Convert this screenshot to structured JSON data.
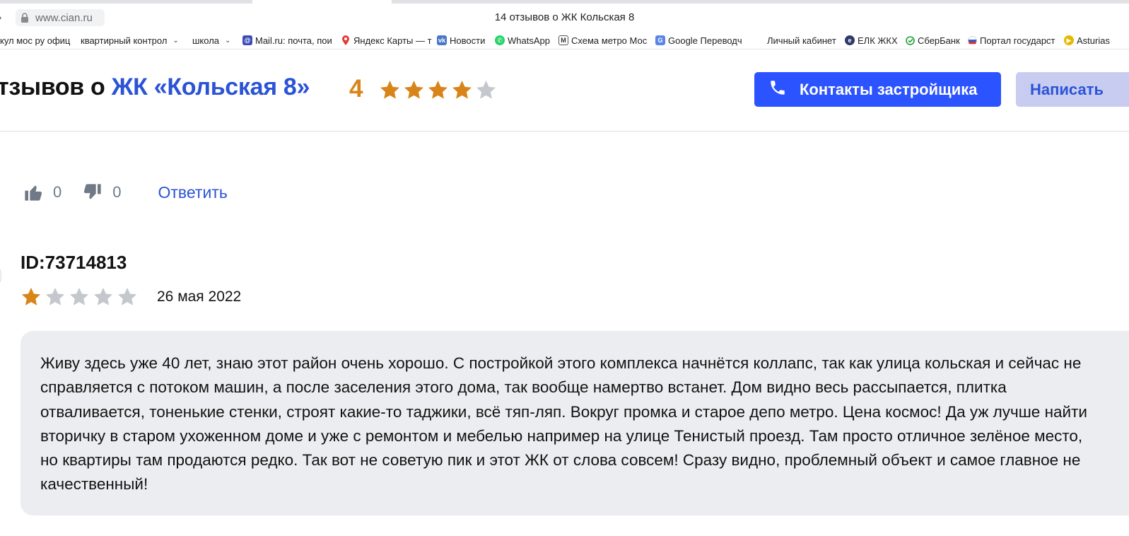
{
  "browser": {
    "url": "www.cian.ru",
    "tab_title": "14 отзывов о ЖК Кольская 8",
    "bookmarks": [
      {
        "label": "кул мос ру офиц",
        "icon": "",
        "dropdown": false
      },
      {
        "label": "квартирный контрол",
        "icon": "",
        "dropdown": true
      },
      {
        "label": "школа",
        "icon": "",
        "dropdown": true
      },
      {
        "label": "Mail.ru: почта, пои",
        "icon": "mail-icon"
      },
      {
        "label": "Яндекс Карты — т",
        "icon": "map-pin-icon"
      },
      {
        "label": "Новости",
        "icon": "vk-icon"
      },
      {
        "label": "WhatsApp",
        "icon": "whatsapp-icon"
      },
      {
        "label": "Схема метро Мос",
        "icon": "metro-icon"
      },
      {
        "label": "Google Переводч",
        "icon": "translate-icon"
      },
      {
        "label": "Личный кабинет",
        "icon": ""
      },
      {
        "label": "ЕЛК ЖКХ",
        "icon": "elk-icon"
      },
      {
        "label": "СберБанк",
        "icon": "sber-icon"
      },
      {
        "label": "Портал государст",
        "icon": "gosuslugi-icon"
      },
      {
        "label": "Asturias",
        "icon": "play-icon"
      }
    ]
  },
  "header": {
    "title_prefix": "тзывов о",
    "title_accent": "ЖК «Кольская 8»",
    "rating": "4",
    "rating_stars": 4,
    "rating_max": 5,
    "contacts_button": "Контакты застройщика",
    "write_button": "Написать"
  },
  "colors": {
    "accent_blue": "#2b53d6",
    "button_blue": "#2b53ff",
    "star_orange": "#d98419",
    "star_gray": "#c4c7cc",
    "bubble_gray": "#ebedf0"
  },
  "prev_review": {
    "likes": "0",
    "dislikes": "0",
    "reply": "Ответить"
  },
  "review": {
    "author": "ID:73714813",
    "stars": 1,
    "max_stars": 5,
    "date": "26 мая 2022",
    "text": "Живу здесь уже 40 лет, знаю этот район очень хорошо. С постройкой этого комплекса начнётся коллапс, так как улица кольская и сейчас не справляется с потоком машин, а после заселения этого дома, так вообще намертво встанет. Дом видно весь рассыпается, плитка отваливается, тоненькие стенки, строят какие-то таджики, всё тяп-ляп. Вокруг промка и старое депо метро. Цена космос! Да уж лучше найти вторичку в старом ухоженном доме и уже с ремонтом и мебелью например на улице Тенистый проезд. Там просто отличное зелёное место, но квартиры там продаются редко. Так вот не советую пик и этот ЖК от слова совсем! Сразу видно, проблемный объект и самое главное не качественный!"
  }
}
